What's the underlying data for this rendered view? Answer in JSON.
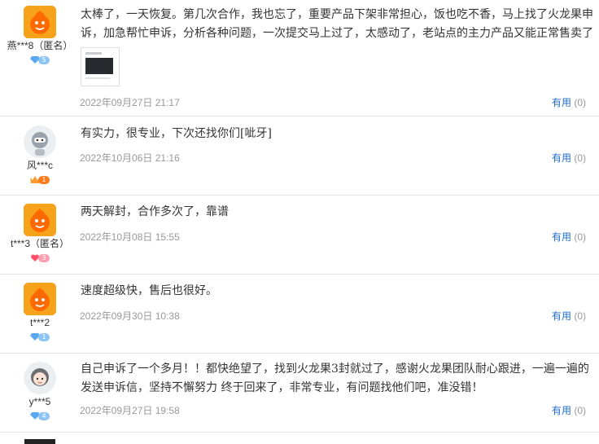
{
  "reviews": [
    {
      "user": "燕***8（匿名）",
      "avatar": "orange-mascot",
      "badge": {
        "icon": "blue-diamond-icon",
        "level": "5",
        "color": "#6db3f2"
      },
      "lines": [
        "太棒了，一天恢复。第几次合作，我也忘了，重要产品下架非常担心，饭也吃不香，马上找了火龙果申",
        "诉，加急帮忙申诉，分析各种问题，一次提交马上过了，太感动了，老站点的主力产品又能正常售卖了"
      ],
      "has_image": true,
      "date": "2022年09月27日 21:17",
      "useful_label": "有用",
      "useful_count": "(0)"
    },
    {
      "user": "风***c",
      "avatar": "gray-robot",
      "badge": {
        "icon": "crown-icon",
        "level": "1",
        "color": "#ff7a1a"
      },
      "lines": [
        "有实力，很专业，下次还找你们[呲牙]"
      ],
      "has_image": false,
      "date": "2022年10月06日 21:16",
      "useful_label": "有用",
      "useful_count": "(0)"
    },
    {
      "user": "t***3（匿名）",
      "avatar": "orange-mascot",
      "badge": {
        "icon": "heart-icon",
        "level": "3",
        "color": "#ff6b81"
      },
      "lines": [
        "两天解封，合作多次了，靠谱"
      ],
      "has_image": false,
      "date": "2022年10月08日 15:55",
      "useful_label": "有用",
      "useful_count": "(0)"
    },
    {
      "user": "t***2",
      "avatar": "orange-mascot",
      "badge": {
        "icon": "blue-diamond-icon",
        "level": "1",
        "color": "#6db3f2"
      },
      "lines": [
        "速度超级快，售后也很好。"
      ],
      "has_image": false,
      "date": "2022年09月30日 10:38",
      "useful_label": "有用",
      "useful_count": "(0)"
    },
    {
      "user": "y***5",
      "avatar": "gray-girl",
      "badge": {
        "icon": "blue-diamond-icon",
        "level": "4",
        "color": "#6db3f2"
      },
      "lines": [
        "自己申诉了一个多月！！都快绝望了，找到火龙果3封就过了，感谢火龙果团队耐心跟进，一遍一遍的",
        "发送申诉信，坚持不懈努力 终于回来了，非常专业，有问题找他们吧，准没错！"
      ],
      "has_image": false,
      "date": "2022年09月27日 19:58",
      "useful_label": "有用",
      "useful_count": "(0)"
    }
  ]
}
